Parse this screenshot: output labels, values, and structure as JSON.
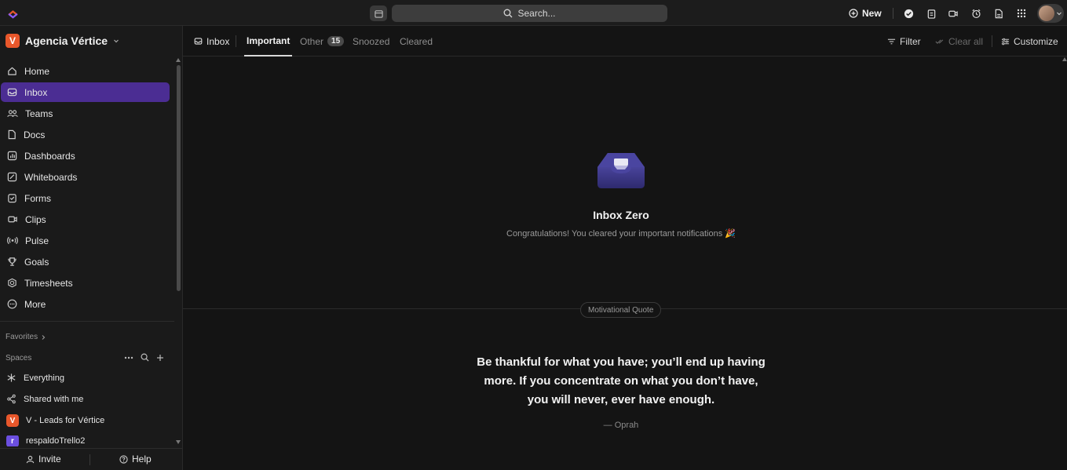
{
  "topbar": {
    "search_placeholder": "Search...",
    "new_label": "New",
    "icons": [
      "check-circle-icon",
      "notepad-icon",
      "video-icon",
      "alarm-clock-icon",
      "document-icon",
      "apps-grid-icon"
    ]
  },
  "workspace": {
    "initial": "V",
    "name": "Agencia Vértice",
    "color": "#e8572b"
  },
  "sidebar": {
    "items": [
      {
        "label": "Home",
        "icon": "home-icon"
      },
      {
        "label": "Inbox",
        "icon": "inbox-icon",
        "active": true
      },
      {
        "label": "Teams",
        "icon": "teams-icon"
      },
      {
        "label": "Docs",
        "icon": "docs-icon"
      },
      {
        "label": "Dashboards",
        "icon": "dashboard-icon"
      },
      {
        "label": "Whiteboards",
        "icon": "whiteboard-icon"
      },
      {
        "label": "Forms",
        "icon": "forms-icon"
      },
      {
        "label": "Clips",
        "icon": "clips-icon"
      },
      {
        "label": "Pulse",
        "icon": "pulse-icon"
      },
      {
        "label": "Goals",
        "icon": "trophy-icon"
      },
      {
        "label": "Timesheets",
        "icon": "timesheet-icon"
      },
      {
        "label": "More",
        "icon": "more-icon"
      }
    ],
    "favorites_label": "Favorites",
    "spaces_label": "Spaces",
    "spaces": [
      {
        "label": "Everything",
        "icon": "everything-icon"
      },
      {
        "label": "Shared with me",
        "icon": "share-icon"
      },
      {
        "label": "V - Leads for Vértice",
        "initial": "V",
        "color": "#e8572b"
      },
      {
        "label": "respaldoTrello2",
        "initial": "r",
        "color": "#6b4fe0"
      }
    ],
    "footer": {
      "invite": "Invite",
      "help": "Help"
    }
  },
  "tabs": {
    "inbox": "Inbox",
    "important": "Important",
    "other": "Other",
    "other_count": "15",
    "snoozed": "Snoozed",
    "cleared": "Cleared"
  },
  "toolbar": {
    "filter": "Filter",
    "clear_all": "Clear all",
    "customize": "Customize"
  },
  "empty_state": {
    "title": "Inbox Zero",
    "subtitle": "Congratulations! You cleared your important notifications 🎉"
  },
  "quote": {
    "pill": "Motivational Quote",
    "text": "Be thankful for what you have; you’ll end up having more. If you concentrate on what you don’t have, you will never, ever have enough.",
    "author": "— Oprah"
  },
  "colors": {
    "accent": "#4b2d93",
    "background": "#141414"
  }
}
